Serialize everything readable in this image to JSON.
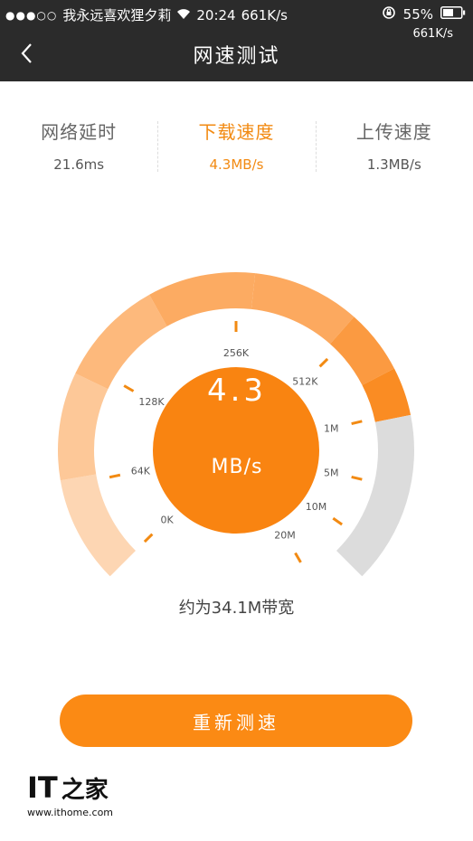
{
  "status_bar": {
    "carrier": "我永远喜欢狸夕莉",
    "time": "20:24",
    "net_speed": "661K/s",
    "battery": "55%",
    "net_speed_secondary": "661K/s",
    "signal_dots_filled": 3,
    "signal_dots_total": 5
  },
  "nav": {
    "title": "网速测试"
  },
  "stats": [
    {
      "label": "网络延时",
      "value": "21.6ms",
      "active": false
    },
    {
      "label": "下载速度",
      "value": "4.3MB/s",
      "active": true
    },
    {
      "label": "上传速度",
      "value": "1.3MB/s",
      "active": false
    }
  ],
  "gauge": {
    "ticks": [
      "0K",
      "64K",
      "128K",
      "256K",
      "512K",
      "1M",
      "5M",
      "10M",
      "20M"
    ],
    "value": "4.3",
    "unit": "MB/s",
    "filled_segments": 7,
    "colors": {
      "accent": "#f98411",
      "center": "#f98411",
      "track_empty": "#dcdcdc",
      "tick": "#f28a12",
      "segments": [
        "#fdd6b3",
        "#fdc898",
        "#fdb97c",
        "#fcab62",
        "#fca95f",
        "#fb9a41",
        "#fa8c23",
        "#dcdcdc"
      ]
    }
  },
  "bandwidth_text": "约为34.1M带宽",
  "retest_label": "重新测速",
  "watermark": {
    "logo_it": "IT",
    "logo_cn": "之家",
    "url": "www.ithome.com"
  }
}
